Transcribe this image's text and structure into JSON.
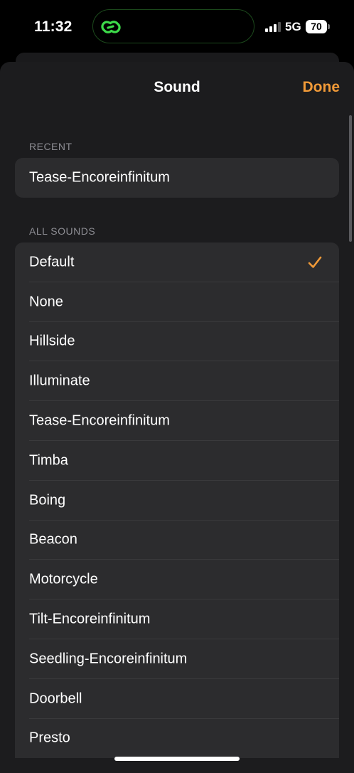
{
  "status_bar": {
    "time": "11:32",
    "network": "5G",
    "battery": "70",
    "island_icon": "link-icon"
  },
  "nav": {
    "title": "Sound",
    "done_label": "Done",
    "accent_color": "#f19a38"
  },
  "recent": {
    "header": "RECENT",
    "items": [
      {
        "label": "Tease-Encoreinfinitum"
      }
    ]
  },
  "all_sounds": {
    "header": "ALL SOUNDS",
    "selected_index": 0,
    "items": [
      {
        "label": "Default"
      },
      {
        "label": "None"
      },
      {
        "label": "Hillside"
      },
      {
        "label": "Illuminate"
      },
      {
        "label": "Tease-Encoreinfinitum"
      },
      {
        "label": "Timba"
      },
      {
        "label": "Boing"
      },
      {
        "label": "Beacon"
      },
      {
        "label": "Motorcycle"
      },
      {
        "label": "Tilt-Encoreinfinitum"
      },
      {
        "label": "Seedling-Encoreinfinitum"
      },
      {
        "label": "Doorbell"
      },
      {
        "label": "Presto"
      }
    ]
  }
}
